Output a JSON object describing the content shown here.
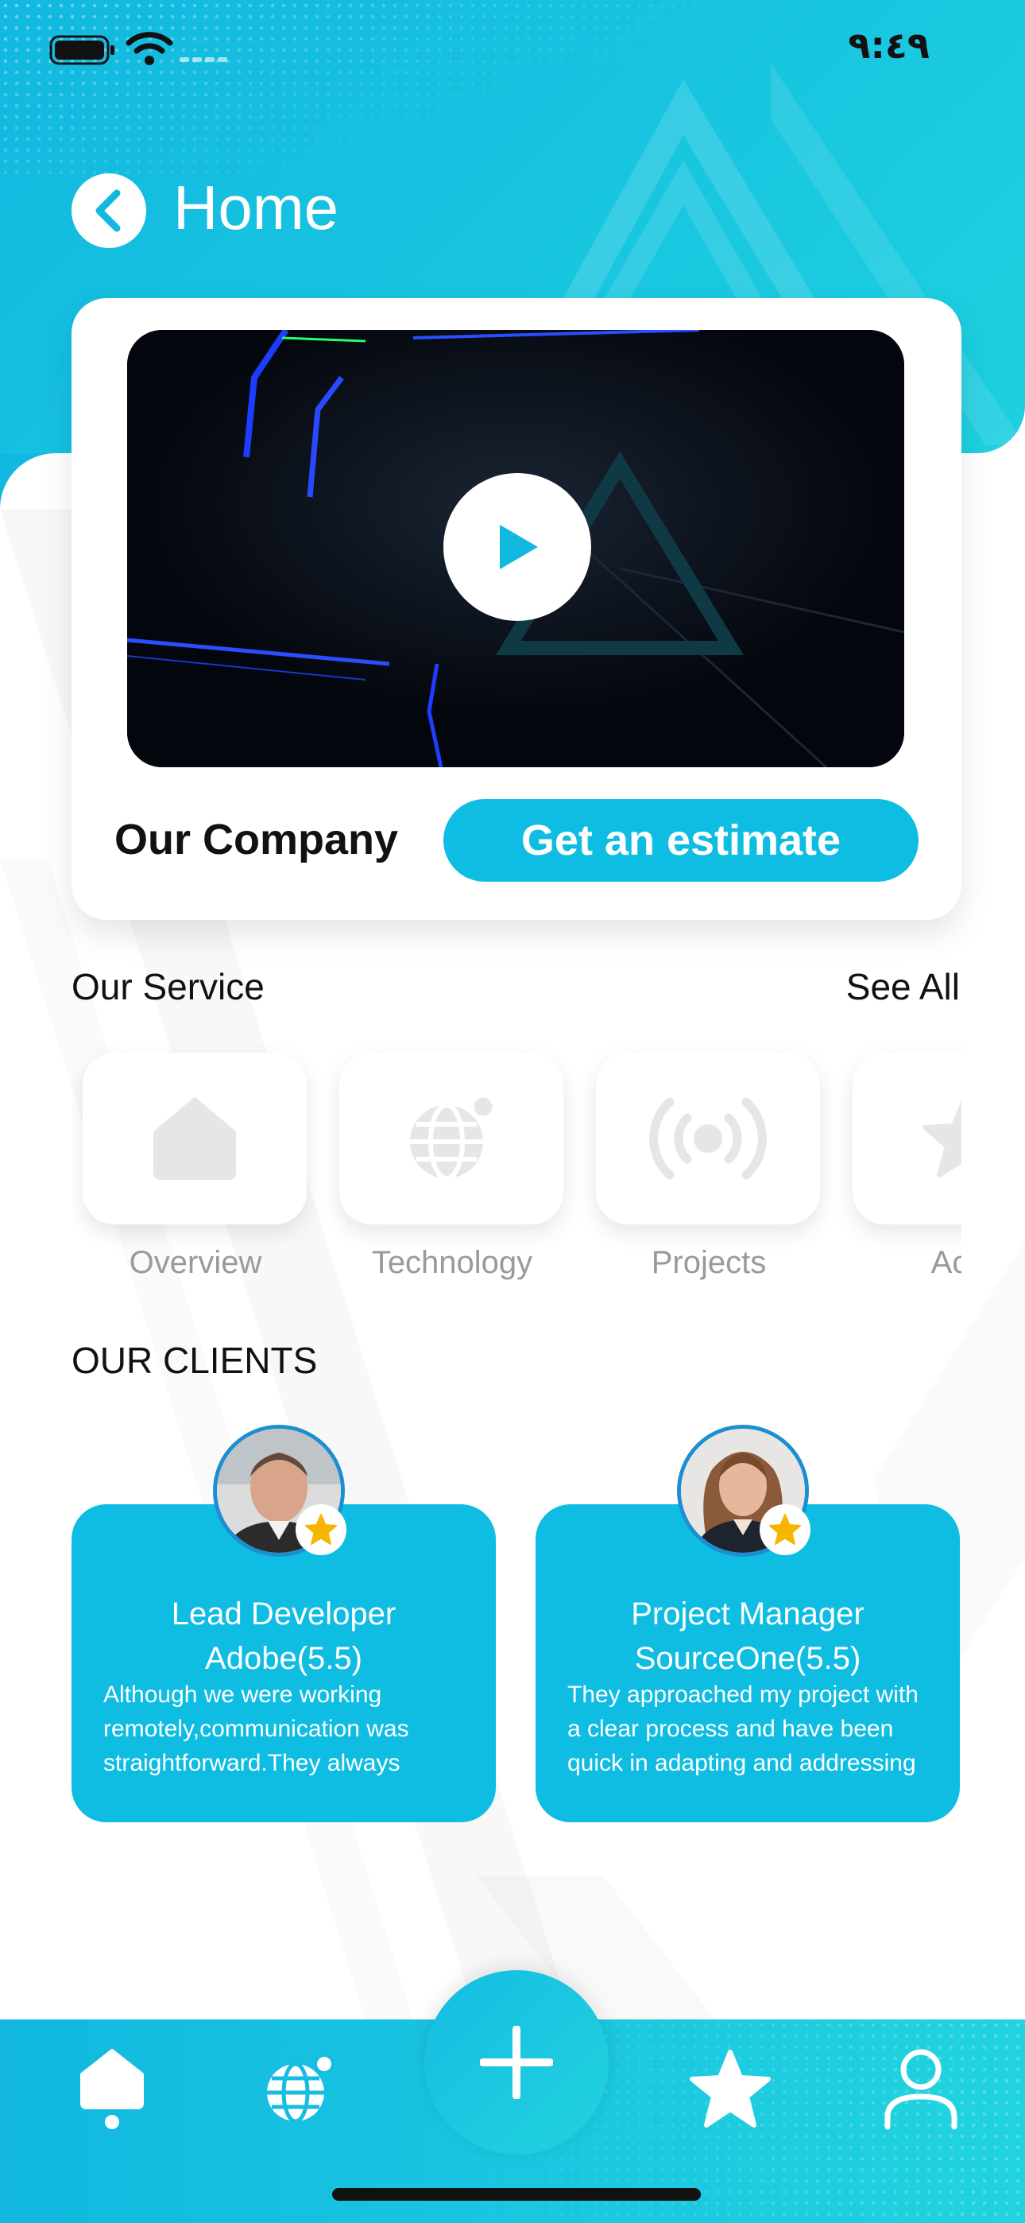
{
  "status_bar": {
    "time": "٩:٤٩"
  },
  "header": {
    "title": "Home"
  },
  "video_card": {
    "company_title": "Our Company",
    "estimate_button": "Get an estimate"
  },
  "services": {
    "title": "Our Service",
    "see_all": "See All",
    "items": [
      {
        "label": "Overview",
        "icon": "home-icon"
      },
      {
        "label": "Technology",
        "icon": "globe-icon"
      },
      {
        "label": "Projects",
        "icon": "broadcast-icon"
      },
      {
        "label": "Activ",
        "icon": "star-icon"
      }
    ]
  },
  "clients": {
    "title": "OUR CLIENTS",
    "items": [
      {
        "role": "Lead Developer",
        "company": "Adobe(5.5)",
        "text": "Although we were working remotely,communication was straightforward.They always"
      },
      {
        "role": "Project Manager",
        "company": "SourceOne(5.5)",
        "text": "They approached my project with a clear process and have been quick in adapting and addressing"
      }
    ]
  },
  "bottom_nav": {
    "items": [
      "home-icon",
      "globe-icon",
      "add-icon",
      "star-icon",
      "user-icon"
    ]
  },
  "colors": {
    "accent": "#0fbde3",
    "accent_light": "#21d3df",
    "star": "#f7b500"
  }
}
